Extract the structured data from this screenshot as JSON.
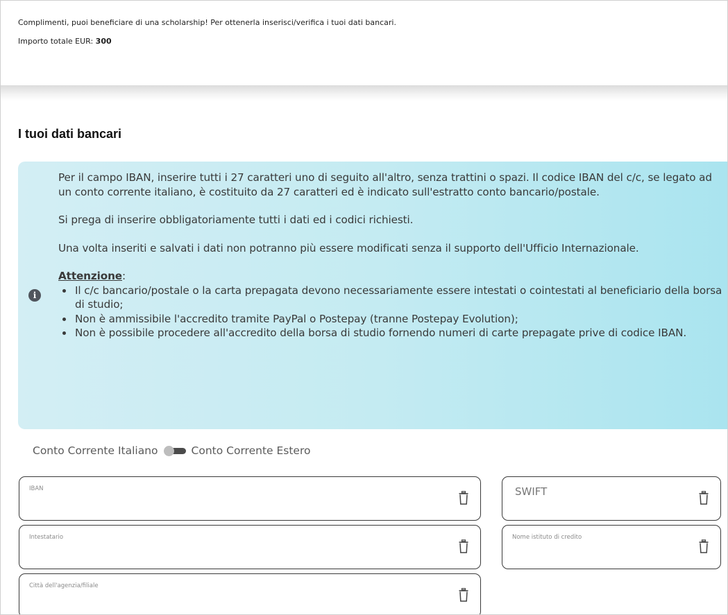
{
  "banner": {
    "message": "Complimenti, puoi beneficiare di una scholarship! Per ottenerla inserisci/verifica i tuoi dati bancari.",
    "amount_label": "Importo totale EUR:",
    "amount_value": "300"
  },
  "section": {
    "title": "I tuoi dati bancari"
  },
  "info": {
    "icon": "info-circle-icon",
    "paragraph1": "Per il campo IBAN, inserire tutti i 27 caratteri uno di seguito all'altro, senza trattini o spazi. Il codice IBAN del c/c, se legato ad un conto corrente italiano, è costituito da 27 caratteri ed è indicato sull'estratto conto bancario/postale.",
    "paragraph2": "Si prega di inserire obbligatoriamente tutti i dati ed i codici richiesti.",
    "paragraph3": "Una volta inseriti e salvati i dati non potranno più essere modificati senza il supporto dell'Ufficio Internazionale.",
    "attention_label": "Attenzione",
    "attention_colon": ":",
    "bullets": [
      "Il c/c bancario/postale o la carta prepagata devono necessariamente essere intestati o cointestati al beneficiario della borsa di studio;",
      "Non è ammissibile l'accredito tramite PayPal o Postepay (tranne Postepay Evolution);",
      "Non è possibile procedere all'accredito della borsa di studio fornendo numeri di carte prepagate prive di codice IBAN."
    ]
  },
  "account_toggle": {
    "left_label": "Conto Corrente Italiano",
    "right_label": "Conto Corrente Estero",
    "selected": "Conto Corrente Italiano"
  },
  "fields": {
    "iban": {
      "label": "IBAN",
      "value": ""
    },
    "swift": {
      "label": "SWIFT",
      "value": ""
    },
    "holder": {
      "label": "Intestatario",
      "value": ""
    },
    "bank": {
      "label": "Nome istituto di credito",
      "value": ""
    },
    "city": {
      "label": "Città dell'agenzia/filiale",
      "value": ""
    }
  },
  "icons": {
    "clear": "trash-icon"
  },
  "colors": {
    "info_bg_start": "#d3eef4",
    "info_bg_end": "#a9e4ef",
    "field_border": "#3a3a3a"
  }
}
